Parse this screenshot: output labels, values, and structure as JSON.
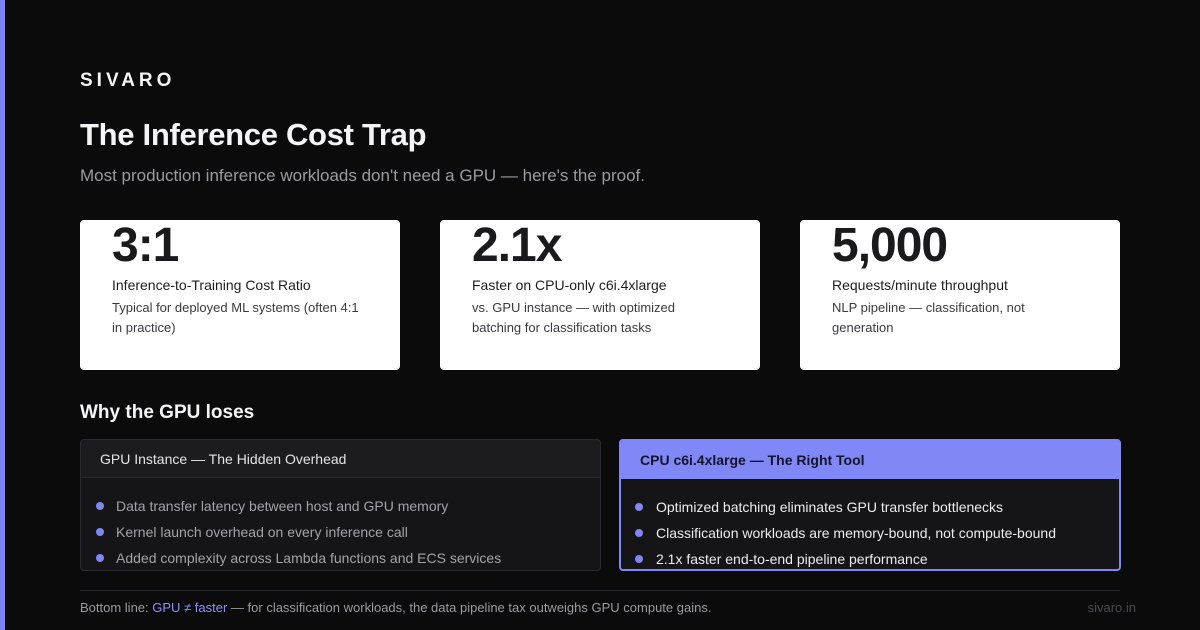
{
  "brand": "SIVARO",
  "title": "The Inference Cost Trap",
  "subtitle": "Most production inference workloads don't need a GPU — here's the proof.",
  "stats": [
    {
      "value": "3:1",
      "label": "Inference-to-Training Cost Ratio",
      "desc": "Typical for deployed ML systems (often 4:1 in practice)"
    },
    {
      "value": "2.1x",
      "label": "Faster on CPU-only c6i.4xlarge",
      "desc": "vs. GPU instance — with optimized batching for classification tasks"
    },
    {
      "value": "5,000",
      "label": "Requests/minute throughput",
      "desc": "NLP pipeline — classification, not generation"
    }
  ],
  "section_title": "Why the GPU loses",
  "gpu_panel": {
    "title": "GPU Instance — The Hidden Overhead",
    "items": [
      "Data transfer latency between host and GPU memory",
      "Kernel launch overhead on every inference call",
      "Added complexity across Lambda functions and ECS services"
    ]
  },
  "cpu_panel": {
    "title": "CPU c6i.4xlarge — The Right Tool",
    "items": [
      "Optimized batching eliminates GPU transfer bottlenecks",
      "Classification workloads are memory-bound, not compute-bound",
      "2.1x faster end-to-end pipeline performance"
    ]
  },
  "footer": {
    "prefix": "Bottom line: ",
    "highlight": "GPU ≠ faster",
    "suffix": " — for classification workloads, the data pipeline tax outweighs GPU compute gains."
  },
  "site": "sivaro.in",
  "colors": {
    "accent": "#7b84f5",
    "background": "#0b0b0c",
    "card": "#ffffff"
  }
}
